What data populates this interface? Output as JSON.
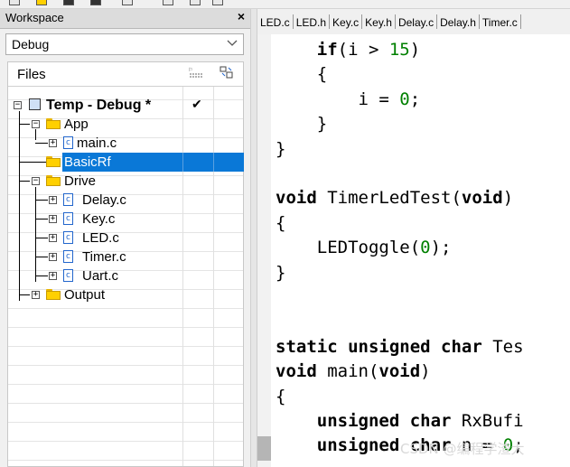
{
  "workspace": {
    "title": "Workspace",
    "close": "×",
    "config": "Debug",
    "tree_header": "Files",
    "nodes": [
      {
        "label": "Temp - Debug *",
        "check": "✔"
      },
      {
        "label": "App"
      },
      {
        "label": "main.c"
      },
      {
        "label": "BasicRf"
      },
      {
        "label": "Drive"
      },
      {
        "label": "Delay.c"
      },
      {
        "label": "Key.c"
      },
      {
        "label": "LED.c"
      },
      {
        "label": "Timer.c"
      },
      {
        "label": "Uart.c"
      },
      {
        "label": "Output"
      }
    ]
  },
  "editor": {
    "tabs": [
      "LED.c",
      "LED.h",
      "Key.c",
      "Key.h",
      "Delay.c",
      "Delay.h",
      "Timer.c"
    ],
    "lines": [
      [
        "    ",
        {
          "k": "if"
        },
        "(i > ",
        {
          "n": "15"
        },
        ")"
      ],
      [
        "    {"
      ],
      [
        "        i = ",
        {
          "n": "0"
        },
        ";"
      ],
      [
        "    }"
      ],
      [
        "}"
      ],
      [
        ""
      ],
      [
        {
          "k": "void"
        },
        " TimerLedTest(",
        {
          "k": "void"
        },
        ")"
      ],
      [
        "{"
      ],
      [
        "    LEDToggle(",
        {
          "n": "0"
        },
        ");"
      ],
      [
        "}"
      ],
      [
        ""
      ],
      [
        ""
      ],
      [
        {
          "k": "static unsigned char"
        },
        " Tes"
      ],
      [
        {
          "k": "void"
        },
        " main(",
        {
          "k": "void"
        },
        ")"
      ],
      [
        "{"
      ],
      [
        "    ",
        {
          "k": "unsigned char"
        },
        " RxBufi"
      ],
      [
        "    ",
        {
          "k": "unsigned char"
        },
        " n = ",
        {
          "n": "0"
        },
        ";"
      ]
    ]
  },
  "watermark": "CSDN @编程学渣大",
  "colors": {
    "selection": "#0a78d7",
    "number": "#008000",
    "folder": "#ffd000"
  }
}
